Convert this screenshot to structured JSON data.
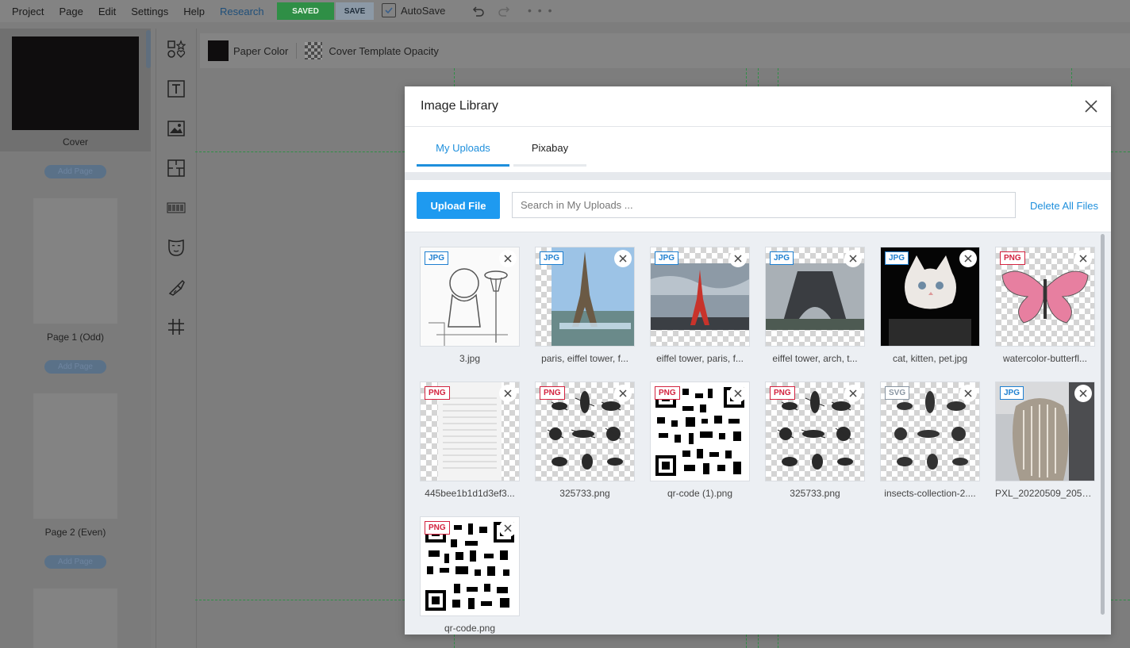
{
  "menu": [
    "Project",
    "Page",
    "Edit",
    "Settings",
    "Help"
  ],
  "menu_link": "Research",
  "toolbar": {
    "saved_label": "SAVED",
    "save_label": "SAVE",
    "autosave_label": "AutoSave",
    "more_label": "• • •"
  },
  "pages": {
    "cover_label": "Cover",
    "add_page_label": "Add Page",
    "page1_label": "Page 1 (Odd)",
    "page2_label": "Page 2 (Even)"
  },
  "propbar": {
    "paper_color_label": "Paper Color",
    "opacity_label": "Cover Template Opacity"
  },
  "modal": {
    "title": "Image Library",
    "tabs": [
      "My Uploads",
      "Pixabay"
    ],
    "upload_label": "Upload File",
    "search_placeholder": "Search in My Uploads ...",
    "delete_all_label": "Delete All Files",
    "items": [
      {
        "type": "JPG",
        "name": "3.jpg"
      },
      {
        "type": "JPG",
        "name": "paris, eiffel tower, f..."
      },
      {
        "type": "JPG",
        "name": "eiffel tower, paris, f..."
      },
      {
        "type": "JPG",
        "name": "eiffel tower, arch, t..."
      },
      {
        "type": "JPG",
        "name": "cat, kitten, pet.jpg"
      },
      {
        "type": "PNG",
        "name": "watercolor-butterfl..."
      },
      {
        "type": "PNG",
        "name": "445bee1b1d1d3ef3..."
      },
      {
        "type": "PNG",
        "name": "325733.png"
      },
      {
        "type": "PNG",
        "name": "qr-code (1).png"
      },
      {
        "type": "PNG",
        "name": "325733.png"
      },
      {
        "type": "SVG",
        "name": "insects-collection-2...."
      },
      {
        "type": "JPG",
        "name": "PXL_20220509_2050..."
      },
      {
        "type": "PNG",
        "name": "qr-code.png"
      }
    ]
  },
  "colors": {
    "accent": "#1e9af0",
    "saved": "#2f8f46",
    "png_badge": "#d3233f",
    "jpg_badge": "#1e7fd0"
  }
}
